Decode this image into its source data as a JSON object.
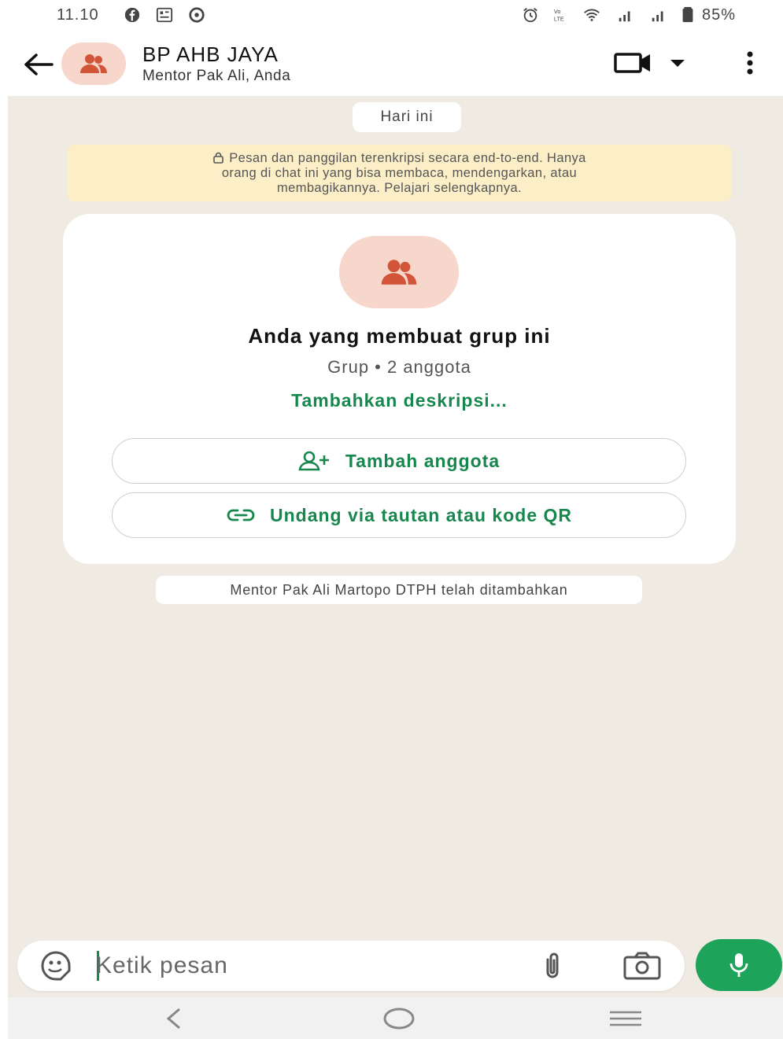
{
  "status_bar": {
    "time": "11.10",
    "battery": "85%",
    "left_icons": [
      "facebook-icon",
      "gallery-icon",
      "app-icon"
    ],
    "right_icons": [
      "alarm-icon",
      "volte-icon",
      "wifi-icon",
      "signal-icon",
      "signal-icon",
      "battery-icon"
    ]
  },
  "header": {
    "title": "BP AHB JAYA",
    "subtitle": "Mentor Pak Ali, Anda",
    "icons": [
      "back-arrow-icon",
      "group-icon",
      "video-call-icon",
      "dropdown-caret-icon",
      "more-vertical-icon"
    ]
  },
  "chat": {
    "day_label": "Hari ini",
    "encryption_notice": {
      "line1": "Pesan dan panggilan terenkripsi secara end-to-end. Hanya",
      "line2": "orang di chat ini yang bisa membaca, mendengarkan, atau",
      "line3": "membagikannya. Pelajari selengkapnya."
    },
    "group_card": {
      "title": "Anda yang membuat grup ini",
      "subtitle": "Grup • 2 anggota",
      "description_link": "Tambahkan deskripsi...",
      "add_member_label": "Tambah anggota",
      "invite_label": "Undang via tautan atau kode QR"
    },
    "system_message": "Mentor Pak Ali Martopo DTPH telah ditambahkan"
  },
  "composer": {
    "placeholder": "Ketik pesan"
  },
  "colors": {
    "accent_green": "#17874d",
    "mic_green": "#1ea35a",
    "avatar_bg": "#f7d6cb",
    "avatar_icon": "#d2553a",
    "chat_bg": "#efeae2",
    "notice_bg": "#fcefc8"
  }
}
